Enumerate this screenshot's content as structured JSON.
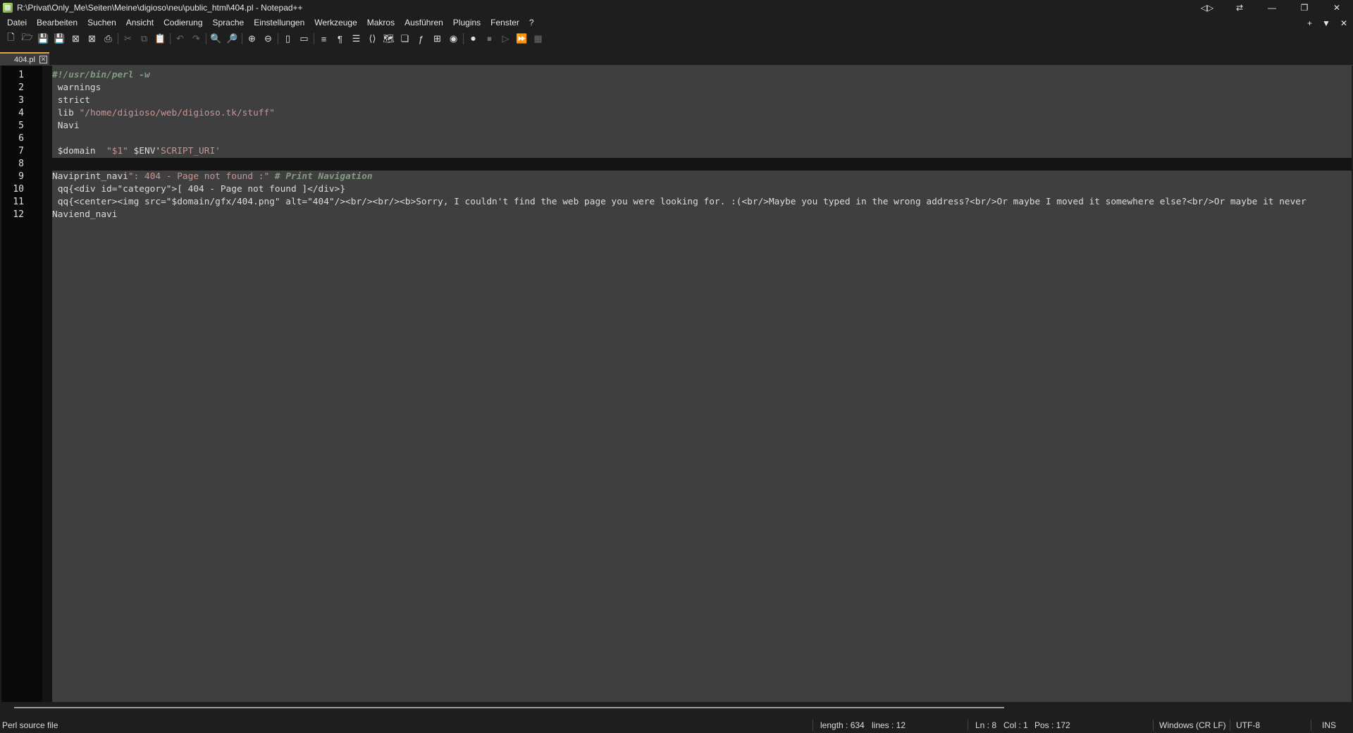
{
  "window": {
    "title": "R:\\Privat\\Only_Me\\Seiten\\Meine\\digioso\\neu\\public_html\\404.pl - Notepad++",
    "controls": {
      "split": "◁▷",
      "sendto": "⇄",
      "minimize": "—",
      "maximize": "❐",
      "close": "✕"
    }
  },
  "menu": {
    "items": [
      "Datei",
      "Bearbeiten",
      "Suchen",
      "Ansicht",
      "Codierung",
      "Sprache",
      "Einstellungen",
      "Werkzeuge",
      "Makros",
      "Ausführen",
      "Plugins",
      "Fenster",
      "?"
    ],
    "right": {
      "add": "+",
      "list": "▼",
      "close": "✕"
    }
  },
  "toolbar": {
    "buttons": [
      {
        "name": "new-file-icon",
        "glyph": "🗋"
      },
      {
        "name": "open-file-icon",
        "glyph": "🗁"
      },
      {
        "name": "save-icon",
        "glyph": "💾",
        "dim": true
      },
      {
        "name": "save-all-icon",
        "glyph": "💾",
        "dim": true
      },
      {
        "name": "close-icon",
        "glyph": "⊠"
      },
      {
        "name": "close-all-icon",
        "glyph": "⊠"
      },
      {
        "name": "print-icon",
        "glyph": "⎙"
      },
      {
        "sep": true
      },
      {
        "name": "cut-icon",
        "glyph": "✂",
        "dim": true
      },
      {
        "name": "copy-icon",
        "glyph": "⧉",
        "dim": true
      },
      {
        "name": "paste-icon",
        "glyph": "📋",
        "dim": true
      },
      {
        "sep": true
      },
      {
        "name": "undo-icon",
        "glyph": "↶",
        "dim": true
      },
      {
        "name": "redo-icon",
        "glyph": "↷",
        "dim": true
      },
      {
        "sep": true
      },
      {
        "name": "find-icon",
        "glyph": "🔍"
      },
      {
        "name": "replace-icon",
        "glyph": "🔎"
      },
      {
        "sep": true
      },
      {
        "name": "zoom-in-icon",
        "glyph": "⊕"
      },
      {
        "name": "zoom-out-icon",
        "glyph": "⊖"
      },
      {
        "sep": true
      },
      {
        "name": "sync-vertical-icon",
        "glyph": "▯"
      },
      {
        "name": "sync-horizontal-icon",
        "glyph": "▭"
      },
      {
        "sep": true
      },
      {
        "name": "word-wrap-icon",
        "glyph": "≡"
      },
      {
        "name": "show-all-chars-icon",
        "glyph": "¶"
      },
      {
        "name": "indent-guide-icon",
        "glyph": "☰"
      },
      {
        "name": "xml-tags-icon",
        "glyph": "⟨⟩"
      },
      {
        "name": "document-map-icon",
        "glyph": "🗺"
      },
      {
        "name": "document-list-icon",
        "glyph": "❏"
      },
      {
        "name": "function-list-icon",
        "glyph": "ƒ"
      },
      {
        "name": "folder-workspace-icon",
        "glyph": "⊞"
      },
      {
        "name": "monitoring-icon",
        "glyph": "◉"
      },
      {
        "sep": true
      },
      {
        "name": "record-macro-icon",
        "glyph": "⏺"
      },
      {
        "name": "stop-macro-icon",
        "glyph": "⏹",
        "dim": true
      },
      {
        "name": "play-macro-icon",
        "glyph": "▷",
        "dim": true
      },
      {
        "name": "run-macro-multiple-icon",
        "glyph": "⏩"
      },
      {
        "name": "save-macro-icon",
        "glyph": "▦",
        "dim": true
      }
    ]
  },
  "tabs": [
    {
      "label": "404.pl",
      "close": "✕"
    }
  ],
  "editor": {
    "current_line": 8,
    "lines": [
      {
        "n": "1",
        "segments": [
          {
            "t": "#!/usr/bin/perl -w",
            "c": "comment"
          }
        ]
      },
      {
        "n": "2",
        "segments": [
          {
            "t": " warnings",
            "c": "plain"
          }
        ]
      },
      {
        "n": "3",
        "segments": [
          {
            "t": " strict",
            "c": "plain"
          }
        ]
      },
      {
        "n": "4",
        "segments": [
          {
            "t": " lib ",
            "c": "plain"
          },
          {
            "t": "\"/home/digioso/web/digioso.tk/stuff\"",
            "c": "string"
          }
        ]
      },
      {
        "n": "5",
        "segments": [
          {
            "t": " Navi",
            "c": "plain"
          }
        ]
      },
      {
        "n": "6",
        "segments": []
      },
      {
        "n": "7",
        "segments": [
          {
            "t": " $domain  ",
            "c": "plain"
          },
          {
            "t": "\"$1\"",
            "c": "string"
          },
          {
            "t": " $ENV'",
            "c": "plain"
          },
          {
            "t": "SCRIPT_URI'",
            "c": "string"
          }
        ]
      },
      {
        "n": "8",
        "segments": []
      },
      {
        "n": "9",
        "segments": [
          {
            "t": "Naviprint_navi",
            "c": "plain"
          },
          {
            "t": "\": 404 - Page not found :\"",
            "c": "string"
          },
          {
            "t": " # Print Navigation",
            "c": "comment"
          }
        ]
      },
      {
        "n": "10",
        "segments": [
          {
            "t": " qq{<div id=\"category\">[ 404 - Page not found ]</div>}",
            "c": "plain"
          }
        ]
      },
      {
        "n": "11",
        "segments": [
          {
            "t": " qq{<center><img src=\"$domain/gfx/404.png\" alt=\"404\"/><br/><br/><b>Sorry, I couldn't find the web page you were looking for. :(<br/>Maybe you typed in the wrong address?<br/>Or maybe I moved it somewhere else?<br/>Or maybe it never",
            "c": "plain"
          }
        ]
      },
      {
        "n": "12",
        "segments": [
          {
            "t": "Naviend_navi",
            "c": "plain"
          }
        ]
      }
    ]
  },
  "status": {
    "file_type": "Perl source file",
    "length": "length : 634",
    "lines": "lines : 12",
    "ln": "Ln : 8",
    "col": "Col : 1",
    "pos": "Pos : 172",
    "eol": "Windows (CR LF)",
    "encoding": "UTF-8",
    "mode": "INS"
  },
  "colors": {
    "accent_tab": "#e6a046",
    "comment": "#7f9f7f",
    "string": "#cc9393",
    "editor_bg": "#3f3f3f"
  }
}
